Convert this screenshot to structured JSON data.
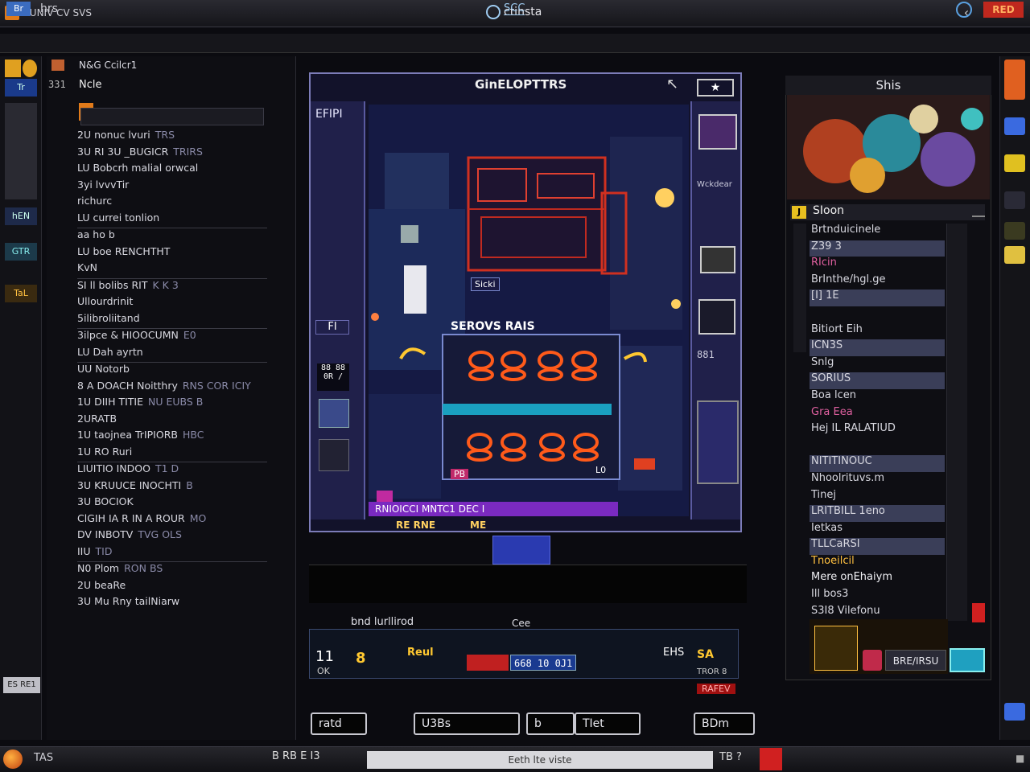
{
  "window": {
    "app_title": "UUNIV CV SVS",
    "title": "ctinsta",
    "tab_left": "Br",
    "tab_label": "hrs",
    "tab_center": "SCC",
    "tab_right_badge": "RED"
  },
  "left_rail": {
    "items": [
      "Tr",
      "hEN",
      "GTR",
      "TaL"
    ],
    "status_chip": "ES RE1"
  },
  "left_panel": {
    "header": "N&G Ccilcr1",
    "number": "331",
    "subheader": "Ncle",
    "rows": [
      {
        "text": "2U nonuc lvuri",
        "sub": "TRS"
      },
      {
        "text": "3U RI 3U _BUGICR",
        "sub": "TRIRS"
      },
      {
        "text": "LU Bobcrh malial orwcal",
        "sub": ""
      },
      {
        "text": "3yi lvvvTir",
        "sub": ""
      },
      {
        "text": "richurc",
        "sub": ""
      },
      {
        "text": "LU currei tonlion",
        "sub": ""
      },
      {
        "text": "aa ho b",
        "sub": ""
      },
      {
        "text": "LU boe RENCHTHT",
        "sub": ""
      },
      {
        "text": "KvN",
        "sub": ""
      },
      {
        "text": "SI ll bolibs RIT",
        "sub": "K K 3"
      },
      {
        "text": "Ullourdrinit",
        "sub": ""
      },
      {
        "text": "5ilibroliitand",
        "sub": ""
      },
      {
        "text": "3ilpce & HIOOCUMN",
        "sub": "E0"
      },
      {
        "text": "LU Dah ayrtn",
        "sub": ""
      },
      {
        "text": "UU Notorb",
        "sub": ""
      },
      {
        "text": "8 A DOACH Noitthry",
        "sub": "RNS COR ICIY"
      },
      {
        "text": "1U DIIH TITIE",
        "sub": "NU EUBS B"
      },
      {
        "text": "2URATB",
        "sub": ""
      },
      {
        "text": "1U taojnea TrIPIORB",
        "sub": "HBC"
      },
      {
        "text": "1U RO Ruri",
        "sub": ""
      },
      {
        "text": "LIUITIO INDOO",
        "sub": "T1 D"
      },
      {
        "text": "3U KRUUCE INOCHTI",
        "sub": "B"
      },
      {
        "text": "3U BOCIOK",
        "sub": ""
      },
      {
        "text": "ClGIH IA R IN A ROUR",
        "sub": "MO"
      },
      {
        "text": "DV INBOTV",
        "sub": "TVG OLS"
      },
      {
        "text": "IIU",
        "sub": "TID"
      },
      {
        "text": "N0 Plom",
        "sub": "RON BS"
      },
      {
        "text": "2U beaRe",
        "sub": ""
      },
      {
        "text": "3U Mu Rny tailNiarw",
        "sub": ""
      }
    ]
  },
  "game": {
    "title": "GinELOPTTRS",
    "star_button": "★",
    "left_label": "EFIPI",
    "left_mid": "FI",
    "left_box": "88 88 0R /",
    "right_label": "Wckdear",
    "right_num": "881",
    "stage_title": "SEROVS RAIS",
    "sign": "Sicki",
    "pb": "PB",
    "lo": "L0",
    "hud_bar": "RNIOICCI MNTC1 DEC I",
    "bottom_label_1": "RE RNE",
    "bottom_label_2": "ME"
  },
  "controls": {
    "row1_a": "bnd lurllirod",
    "row1_b": "Cee",
    "hud_left": "11",
    "hud_left_sub": "OK",
    "hud_gold": "8",
    "hud_red_label": "Reul",
    "hud_bar_text": "668 10 0J1",
    "hud_score": "EHS",
    "hud_rank": "SA",
    "hud_rank_sub": "TROR 8",
    "hud_red_tag": "RAFEV",
    "buttons": [
      "ratd",
      "U3Bs",
      "b",
      "TIet",
      "BDm"
    ]
  },
  "right_panel": {
    "title": "Shis",
    "list_header_icon": "J",
    "list_header": "SIoon",
    "rows": [
      {
        "text": "Brtnduicinele",
        "style": ""
      },
      {
        "text": "Z39 3",
        "style": "hl"
      },
      {
        "text": "RIcin",
        "style": "pink"
      },
      {
        "text": "BrInthe/hgl.ge",
        "style": ""
      },
      {
        "text": "[I] 1E",
        "style": "hl"
      },
      {
        "text": "",
        "style": ""
      },
      {
        "text": "Bitiort Eih",
        "style": ""
      },
      {
        "text": "ICN3S",
        "style": "hl"
      },
      {
        "text": "Snlg",
        "style": ""
      },
      {
        "text": "SORIUS",
        "style": "hl"
      },
      {
        "text": "Boa lcen",
        "style": ""
      },
      {
        "text": "Gra Eea",
        "style": "pink"
      },
      {
        "text": "Hej IL RALATIUD",
        "style": ""
      },
      {
        "text": "",
        "style": ""
      },
      {
        "text": "NITITINOUC",
        "style": "hl"
      },
      {
        "text": "Nhoolrituvs.m",
        "style": ""
      },
      {
        "text": "Tinej",
        "style": ""
      },
      {
        "text": "LRITBILL 1eno",
        "style": "hl"
      },
      {
        "text": "Ietkas",
        "style": ""
      },
      {
        "text": "TLLCaRSI",
        "style": "hl"
      },
      {
        "text": "Tnoeilcil",
        "style": "orange"
      },
      {
        "text": "Mere onEhaiym",
        "style": "lt"
      },
      {
        "text": "Ill bos3",
        "style": ""
      },
      {
        "text": "S3I8 Vilefonu",
        "style": ""
      }
    ],
    "bottom_label": "BRE/IRSU"
  },
  "taskbar": {
    "label": "TAS",
    "left_icons": "B RB E I3",
    "search_text": "Eeth lte viste",
    "right_icons": "TB ?",
    "tray": "■"
  },
  "colors": {
    "accent_blue": "#3b6cc0",
    "alert_red": "#d02020",
    "game_frame": "#7c7cb8",
    "gold": "#ffc830"
  }
}
